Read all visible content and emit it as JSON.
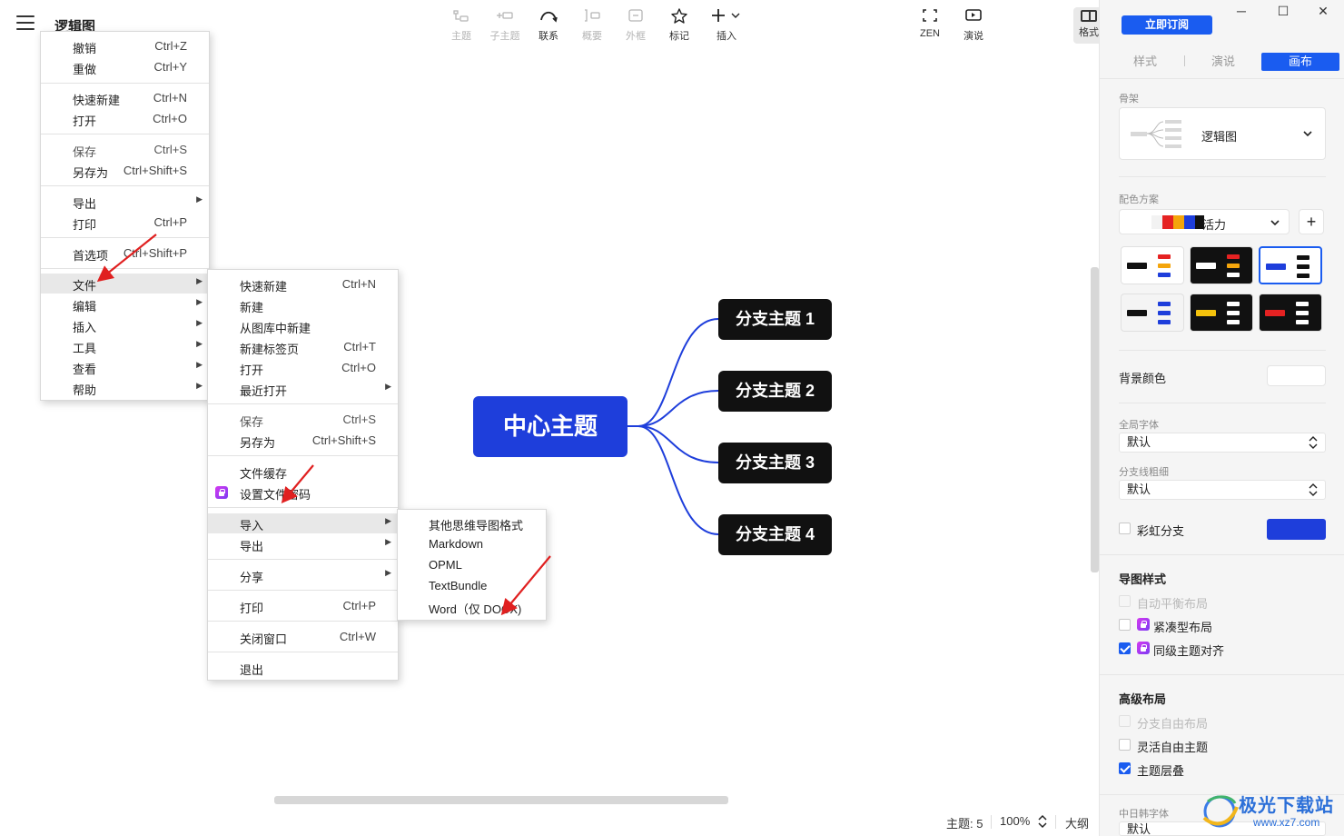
{
  "app": {
    "title": "逻辑图"
  },
  "toolbar": {
    "items": [
      {
        "label": "主题",
        "icon": "topic-icon",
        "enabled": false
      },
      {
        "label": "子主题",
        "icon": "subtopic-icon",
        "enabled": false
      },
      {
        "label": "联系",
        "icon": "relationship-icon",
        "enabled": true
      },
      {
        "label": "概要",
        "icon": "summary-icon",
        "enabled": false
      },
      {
        "label": "外框",
        "icon": "boundary-icon",
        "enabled": false
      },
      {
        "label": "标记",
        "icon": "star-icon",
        "enabled": true
      },
      {
        "label": "插入",
        "icon": "plus-icon",
        "enabled": true
      },
      {
        "label": "ZEN",
        "icon": "fullscreen-icon",
        "enabled": true
      },
      {
        "label": "演说",
        "icon": "present-icon",
        "enabled": true
      },
      {
        "label": "格式",
        "icon": "format-panel-icon",
        "enabled": true
      }
    ],
    "subscribe_label": "立即订阅"
  },
  "window_controls": [
    "─",
    "☐",
    "✕"
  ],
  "panel": {
    "tabs": [
      "样式",
      "演说",
      "画布"
    ],
    "active_tab": "画布",
    "skeleton_label": "骨架",
    "skeleton_value": "逻辑图",
    "color_scheme_label": "配色方案",
    "color_scheme_value": "活力",
    "add_label": "+",
    "bg_color_label": "背景颜色",
    "global_font_label": "全局字体",
    "global_font_value": "默认",
    "branch_width_label": "分支线粗细",
    "branch_width_value": "默认",
    "rainbow_label": "彩虹分支",
    "map_style_title": "导图样式",
    "map_style_options": [
      {
        "label": "自动平衡布局",
        "checked": false,
        "disabled": true,
        "locked": false
      },
      {
        "label": "紧凑型布局",
        "checked": false,
        "disabled": false,
        "locked": true
      },
      {
        "label": "同级主题对齐",
        "checked": true,
        "disabled": false,
        "locked": true
      }
    ],
    "advanced_title": "高级布局",
    "advanced_options": [
      {
        "label": "分支自由布局",
        "checked": false,
        "disabled": true
      },
      {
        "label": "灵活自由主题",
        "checked": false,
        "disabled": false
      },
      {
        "label": "主题层叠",
        "checked": true,
        "disabled": false
      }
    ],
    "cjk_font_label": "中日韩字体",
    "cjk_font_value": "默认",
    "colors": {
      "accent": "#1a5cf0",
      "rainbow_swatch": "#1e3edb"
    }
  },
  "canvas": {
    "center_topic": "中心主题",
    "branches": [
      "分支主题 1",
      "分支主题 2",
      "分支主题 3",
      "分支主题 4"
    ],
    "colors": {
      "center": "#1e3edb",
      "branch": "#111111",
      "line": "#1e3edb"
    }
  },
  "status": {
    "topics": "主题: 5",
    "zoom": "100%",
    "outline": "大纲"
  },
  "main_menu": {
    "groups": [
      [
        {
          "label": "撤销",
          "shortcut": "Ctrl+Z"
        },
        {
          "label": "重做",
          "shortcut": "Ctrl+Y"
        }
      ],
      [
        {
          "label": "快速新建",
          "shortcut": "Ctrl+N"
        },
        {
          "label": "打开",
          "shortcut": "Ctrl+O"
        }
      ],
      [
        {
          "label": "保存",
          "shortcut": "Ctrl+S"
        },
        {
          "label": "另存为",
          "shortcut": "Ctrl+Shift+S"
        }
      ],
      [
        {
          "label": "导出",
          "shortcut": "",
          "submenu": true
        },
        {
          "label": "打印",
          "shortcut": "Ctrl+P"
        }
      ],
      [
        {
          "label": "首选项",
          "shortcut": "Ctrl+Shift+P"
        }
      ],
      [
        {
          "label": "文件",
          "submenu": true,
          "highlighted": true
        },
        {
          "label": "编辑",
          "submenu": true
        },
        {
          "label": "插入",
          "submenu": true
        },
        {
          "label": "工具",
          "submenu": true
        },
        {
          "label": "查看",
          "submenu": true
        },
        {
          "label": "帮助",
          "submenu": true
        }
      ]
    ]
  },
  "file_menu": {
    "groups": [
      [
        {
          "label": "快速新建",
          "shortcut": "Ctrl+N"
        },
        {
          "label": "新建",
          "shortcut": ""
        },
        {
          "label": "从图库中新建",
          "shortcut": ""
        },
        {
          "label": "新建标签页",
          "shortcut": "Ctrl+T"
        },
        {
          "label": "打开",
          "shortcut": "Ctrl+O"
        },
        {
          "label": "最近打开",
          "submenu": true
        }
      ],
      [
        {
          "label": "保存",
          "shortcut": "Ctrl+S"
        },
        {
          "label": "另存为",
          "shortcut": "Ctrl+Shift+S"
        }
      ],
      [
        {
          "label": "文件缓存",
          "shortcut": ""
        },
        {
          "label": "设置文件密码",
          "shortcut": "",
          "locked": true
        }
      ],
      [
        {
          "label": "导入",
          "submenu": true,
          "highlighted": true
        },
        {
          "label": "导出",
          "submenu": true
        }
      ],
      [
        {
          "label": "分享",
          "submenu": true
        }
      ],
      [
        {
          "label": "打印",
          "shortcut": "Ctrl+P"
        }
      ],
      [
        {
          "label": "关闭窗口",
          "shortcut": "Ctrl+W"
        }
      ],
      [
        {
          "label": "退出",
          "shortcut": ""
        }
      ]
    ]
  },
  "import_menu": {
    "items": [
      "其他思维导图格式",
      "Markdown",
      "OPML",
      "TextBundle",
      "Word（仅 DOCX)"
    ]
  },
  "watermark": {
    "text": "极光下载站",
    "url": "www.xz7.com"
  }
}
